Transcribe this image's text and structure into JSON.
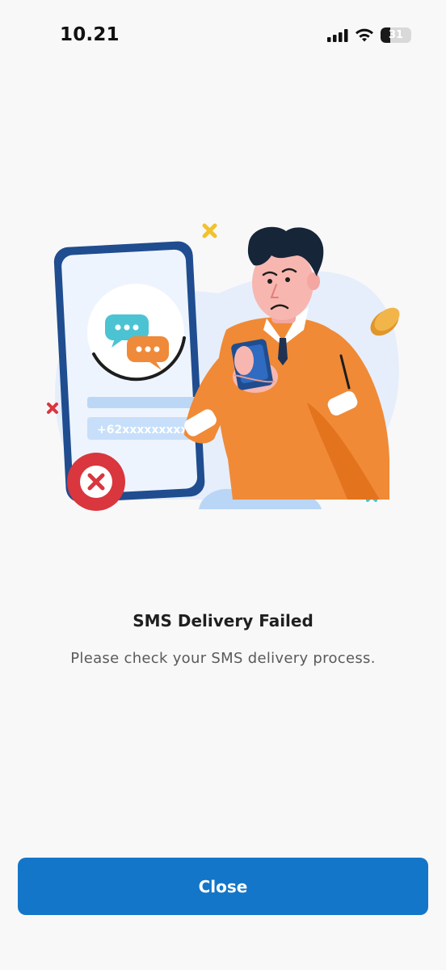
{
  "status_bar": {
    "time": "10.21",
    "battery_level": "31",
    "battery_fraction": 0.31,
    "icons": [
      "cellular-signal-icon",
      "wifi-icon",
      "battery-icon"
    ]
  },
  "illustration": {
    "phone_number_text": "+62xxxxxxxxxx",
    "icons": [
      "chat-bubbles-icon",
      "error-x-icon",
      "confused-man-with-phone-illustration",
      "coin-icon"
    ]
  },
  "message": {
    "title": "SMS Delivery Failed",
    "subtitle": "Please check your SMS delivery process."
  },
  "actions": {
    "close_label": "Close"
  },
  "colors": {
    "primary": "#1476c9",
    "error": "#d9363e",
    "accent_orange": "#ee8a3a",
    "accent_teal": "#4cc3d3",
    "background": "#f8f8f8"
  }
}
